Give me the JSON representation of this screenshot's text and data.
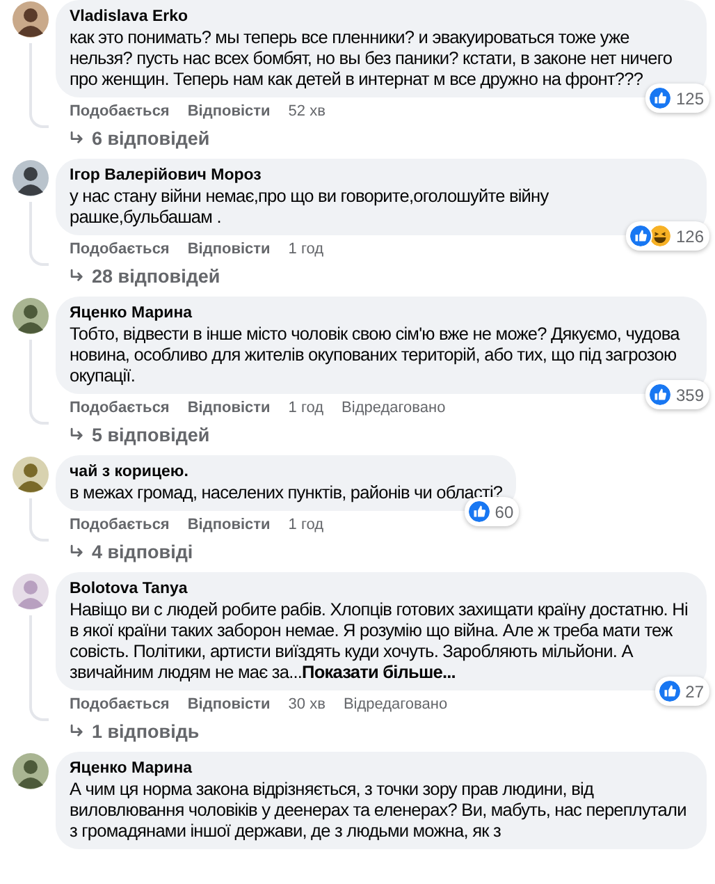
{
  "comments": [
    {
      "author": "Vladislava Erko",
      "text": "как это понимать? мы теперь все пленники? и эвакуироваться тоже уже нельзя? пусть нас всех бомбят, но вы без паники? кстати, в законе нет ничего про женщин. Теперь нам как детей в интернат м все дружно на фронт???",
      "reactions": [
        {
          "kind": "like"
        }
      ],
      "reaction_count": "125",
      "like_label": "Подобається",
      "reply_label": "Відповісти",
      "time": "52 хв",
      "replies": "6 відповідей"
    },
    {
      "author": "Ігор Валерійович Мороз",
      "text": "у нас стану війни немає,про що ви говорите,оголошуйте війну рашке,бульбашам .",
      "reactions": [
        {
          "kind": "like"
        },
        {
          "kind": "haha"
        }
      ],
      "reaction_count": "126",
      "like_label": "Подобається",
      "reply_label": "Відповісти",
      "time": "1 год",
      "replies": "28 відповідей"
    },
    {
      "author": "Яценко Марина",
      "text": "Тобто, відвести в інше місто чоловік свою сім'ю вже не може? Дякуємо, чудова новина, особливо для жителів окупованих територій, або тих, що під загрозою окупації.",
      "reactions": [
        {
          "kind": "like"
        }
      ],
      "reaction_count": "359",
      "like_label": "Подобається",
      "reply_label": "Відповісти",
      "time": "1 год",
      "edited": "Відредаговано",
      "replies": "5 відповідей"
    },
    {
      "author": "чай з корицею.",
      "text": "в межах громад, населених пунктів, районів чи області?",
      "reactions": [
        {
          "kind": "like"
        }
      ],
      "reaction_count": "60",
      "like_label": "Подобається",
      "reply_label": "Відповісти",
      "time": "1 год",
      "replies": "4 відповіді"
    },
    {
      "author": "Bolotova Tanya",
      "text": "Навіщо ви с людей робите рабів. Хлопців готових захищати країну достатню. Ні в якої країни таких заборон немае. Я розумію що війна. Але ж треба мати теж совість. Політики, артисти виїздять куди хочуть. Заробляють мільйони. А звичайним людям не має за...",
      "more_link": "Показати більше...",
      "reactions": [
        {
          "kind": "like"
        }
      ],
      "reaction_count": "27",
      "like_label": "Подобається",
      "reply_label": "Відповісти",
      "time": "30 хв",
      "edited": "Відредаговано",
      "replies": "1 відповідь"
    },
    {
      "author": "Яценко Марина",
      "text": "А чим ця норма закона відрізняється, з точки зору прав людини, від виловлювання чоловіків у деенерах та еленерах? Ви, мабуть, нас переплутали з громадянами іншої держави, де з людьми можна, як з"
    }
  ]
}
